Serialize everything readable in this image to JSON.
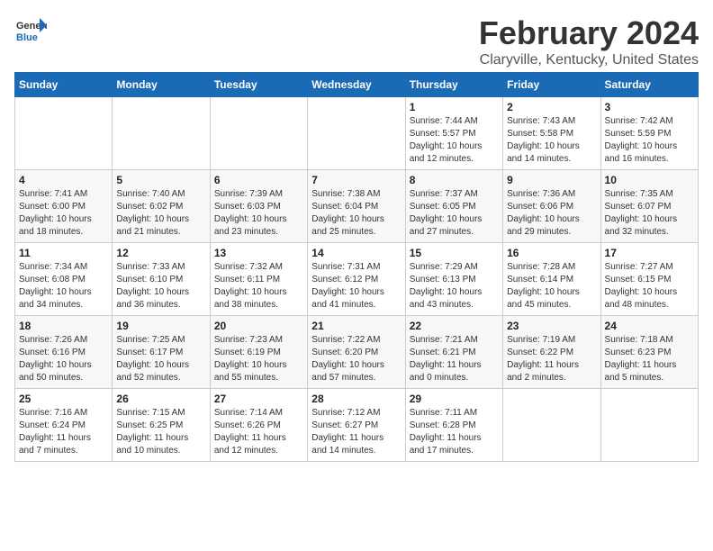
{
  "header": {
    "month_year": "February 2024",
    "location": "Claryville, Kentucky, United States"
  },
  "logo": {
    "line1": "General",
    "line2": "Blue"
  },
  "days_of_week": [
    "Sunday",
    "Monday",
    "Tuesday",
    "Wednesday",
    "Thursday",
    "Friday",
    "Saturday"
  ],
  "weeks": [
    [
      {
        "day": "",
        "info": ""
      },
      {
        "day": "",
        "info": ""
      },
      {
        "day": "",
        "info": ""
      },
      {
        "day": "",
        "info": ""
      },
      {
        "day": "1",
        "info": "Sunrise: 7:44 AM\nSunset: 5:57 PM\nDaylight: 10 hours\nand 12 minutes."
      },
      {
        "day": "2",
        "info": "Sunrise: 7:43 AM\nSunset: 5:58 PM\nDaylight: 10 hours\nand 14 minutes."
      },
      {
        "day": "3",
        "info": "Sunrise: 7:42 AM\nSunset: 5:59 PM\nDaylight: 10 hours\nand 16 minutes."
      }
    ],
    [
      {
        "day": "4",
        "info": "Sunrise: 7:41 AM\nSunset: 6:00 PM\nDaylight: 10 hours\nand 18 minutes."
      },
      {
        "day": "5",
        "info": "Sunrise: 7:40 AM\nSunset: 6:02 PM\nDaylight: 10 hours\nand 21 minutes."
      },
      {
        "day": "6",
        "info": "Sunrise: 7:39 AM\nSunset: 6:03 PM\nDaylight: 10 hours\nand 23 minutes."
      },
      {
        "day": "7",
        "info": "Sunrise: 7:38 AM\nSunset: 6:04 PM\nDaylight: 10 hours\nand 25 minutes."
      },
      {
        "day": "8",
        "info": "Sunrise: 7:37 AM\nSunset: 6:05 PM\nDaylight: 10 hours\nand 27 minutes."
      },
      {
        "day": "9",
        "info": "Sunrise: 7:36 AM\nSunset: 6:06 PM\nDaylight: 10 hours\nand 29 minutes."
      },
      {
        "day": "10",
        "info": "Sunrise: 7:35 AM\nSunset: 6:07 PM\nDaylight: 10 hours\nand 32 minutes."
      }
    ],
    [
      {
        "day": "11",
        "info": "Sunrise: 7:34 AM\nSunset: 6:08 PM\nDaylight: 10 hours\nand 34 minutes."
      },
      {
        "day": "12",
        "info": "Sunrise: 7:33 AM\nSunset: 6:10 PM\nDaylight: 10 hours\nand 36 minutes."
      },
      {
        "day": "13",
        "info": "Sunrise: 7:32 AM\nSunset: 6:11 PM\nDaylight: 10 hours\nand 38 minutes."
      },
      {
        "day": "14",
        "info": "Sunrise: 7:31 AM\nSunset: 6:12 PM\nDaylight: 10 hours\nand 41 minutes."
      },
      {
        "day": "15",
        "info": "Sunrise: 7:29 AM\nSunset: 6:13 PM\nDaylight: 10 hours\nand 43 minutes."
      },
      {
        "day": "16",
        "info": "Sunrise: 7:28 AM\nSunset: 6:14 PM\nDaylight: 10 hours\nand 45 minutes."
      },
      {
        "day": "17",
        "info": "Sunrise: 7:27 AM\nSunset: 6:15 PM\nDaylight: 10 hours\nand 48 minutes."
      }
    ],
    [
      {
        "day": "18",
        "info": "Sunrise: 7:26 AM\nSunset: 6:16 PM\nDaylight: 10 hours\nand 50 minutes."
      },
      {
        "day": "19",
        "info": "Sunrise: 7:25 AM\nSunset: 6:17 PM\nDaylight: 10 hours\nand 52 minutes."
      },
      {
        "day": "20",
        "info": "Sunrise: 7:23 AM\nSunset: 6:19 PM\nDaylight: 10 hours\nand 55 minutes."
      },
      {
        "day": "21",
        "info": "Sunrise: 7:22 AM\nSunset: 6:20 PM\nDaylight: 10 hours\nand 57 minutes."
      },
      {
        "day": "22",
        "info": "Sunrise: 7:21 AM\nSunset: 6:21 PM\nDaylight: 11 hours\nand 0 minutes."
      },
      {
        "day": "23",
        "info": "Sunrise: 7:19 AM\nSunset: 6:22 PM\nDaylight: 11 hours\nand 2 minutes."
      },
      {
        "day": "24",
        "info": "Sunrise: 7:18 AM\nSunset: 6:23 PM\nDaylight: 11 hours\nand 5 minutes."
      }
    ],
    [
      {
        "day": "25",
        "info": "Sunrise: 7:16 AM\nSunset: 6:24 PM\nDaylight: 11 hours\nand 7 minutes."
      },
      {
        "day": "26",
        "info": "Sunrise: 7:15 AM\nSunset: 6:25 PM\nDaylight: 11 hours\nand 10 minutes."
      },
      {
        "day": "27",
        "info": "Sunrise: 7:14 AM\nSunset: 6:26 PM\nDaylight: 11 hours\nand 12 minutes."
      },
      {
        "day": "28",
        "info": "Sunrise: 7:12 AM\nSunset: 6:27 PM\nDaylight: 11 hours\nand 14 minutes."
      },
      {
        "day": "29",
        "info": "Sunrise: 7:11 AM\nSunset: 6:28 PM\nDaylight: 11 hours\nand 17 minutes."
      },
      {
        "day": "",
        "info": ""
      },
      {
        "day": "",
        "info": ""
      }
    ]
  ]
}
